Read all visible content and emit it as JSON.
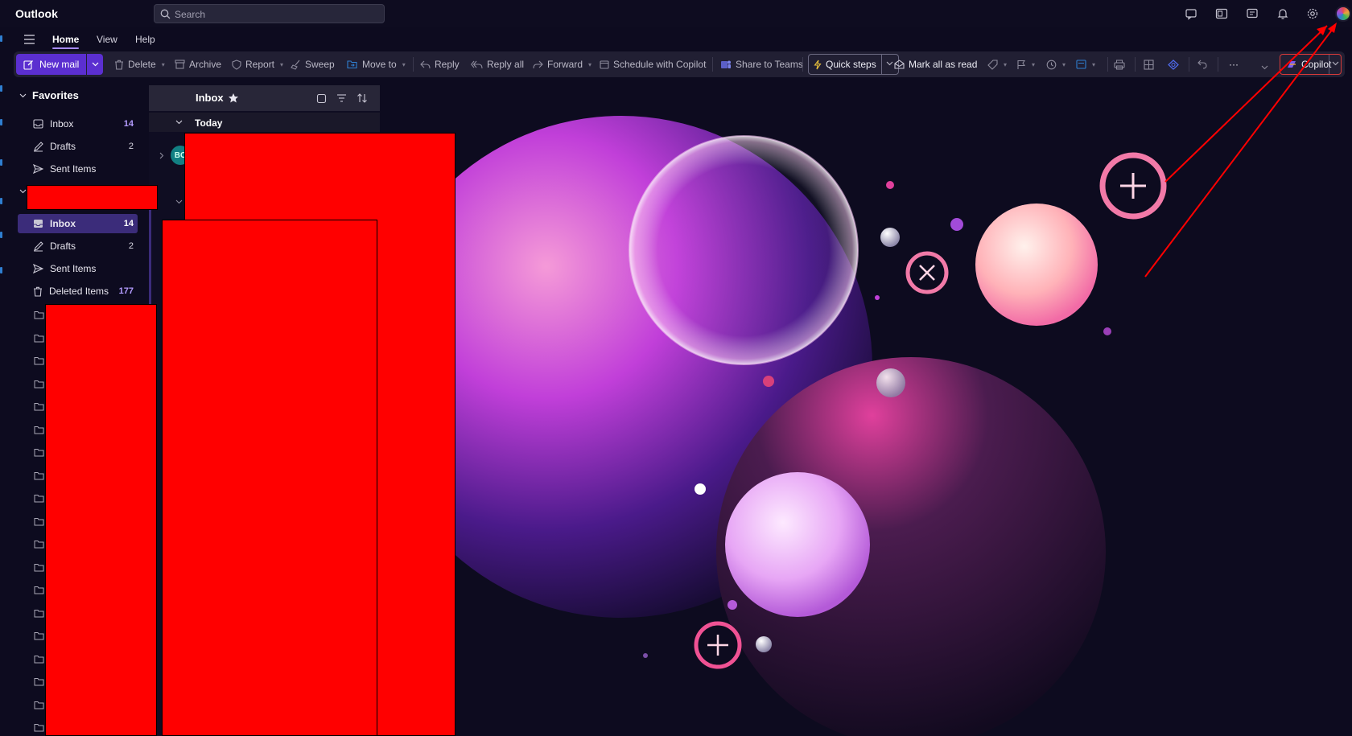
{
  "app": {
    "title": "Outlook"
  },
  "search": {
    "placeholder": "Search"
  },
  "titlebar_icons": [
    "chat-icon",
    "outlook-icon",
    "feedback-icon",
    "bell-icon",
    "gear-icon"
  ],
  "ribbon_tabs": [
    {
      "label": "Home",
      "active": true
    },
    {
      "label": "View",
      "active": false
    },
    {
      "label": "Help",
      "active": false
    }
  ],
  "toolbar": {
    "new_mail": "New mail",
    "delete": "Delete",
    "archive": "Archive",
    "report": "Report",
    "sweep": "Sweep",
    "move_to": "Move to",
    "reply": "Reply",
    "reply_all": "Reply all",
    "forward": "Forward",
    "schedule_with_copilot": "Schedule with Copilot",
    "share_to_teams": "Share to Teams",
    "quick_steps": "Quick steps",
    "mark_all_as_read": "Mark all as read",
    "more": "···",
    "copilot": "Copilot"
  },
  "folders": {
    "favorites_label": "Favorites",
    "favorites": [
      {
        "label": "Inbox",
        "count": "14",
        "icon": "inbox-icon"
      },
      {
        "label": "Drafts",
        "count": "2",
        "icon": "drafts-icon"
      },
      {
        "label": "Sent Items",
        "count": "",
        "icon": "send-icon"
      }
    ],
    "account": [
      {
        "label": "Inbox",
        "count": "14",
        "icon": "inbox-icon",
        "selected": true
      },
      {
        "label": "Drafts",
        "count": "2",
        "icon": "drafts-icon"
      },
      {
        "label": "Sent Items",
        "count": "",
        "icon": "send-icon"
      },
      {
        "label": "Deleted Items",
        "count": "177",
        "icon": "trash-icon"
      }
    ]
  },
  "message_list": {
    "title": "Inbox",
    "group_label": "Today",
    "avatar_initials": "BC"
  },
  "colors": {
    "accent": "#5b2fd0",
    "selected_folder": "#3b2c7a",
    "unread_count": "#b49cff",
    "annotation_red": "#ff0000"
  }
}
